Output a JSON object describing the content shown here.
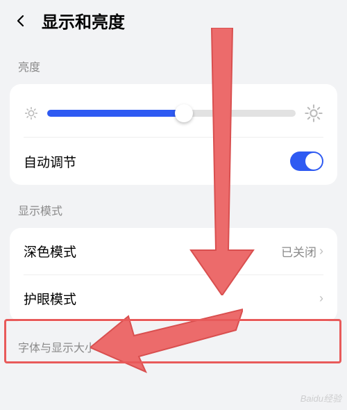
{
  "header": {
    "title": "显示和亮度"
  },
  "brightness": {
    "section_label": "亮度",
    "slider_value": 55,
    "auto_adjust_label": "自动调节",
    "auto_adjust_enabled": true
  },
  "display_mode": {
    "section_label": "显示模式",
    "dark_mode_label": "深色模式",
    "dark_mode_status": "已关闭",
    "eye_comfort_label": "护眼模式"
  },
  "font": {
    "section_label": "字体与显示大小"
  },
  "watermark": "Baidu经验",
  "colors": {
    "accent": "#2e5af2",
    "annotation": "#e85a5a"
  }
}
